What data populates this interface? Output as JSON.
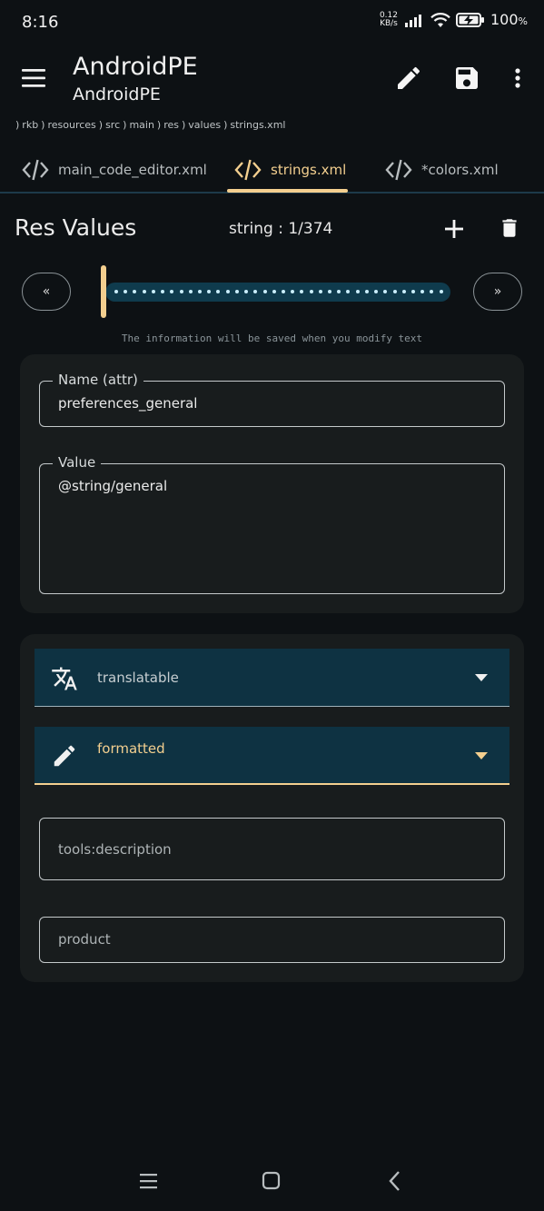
{
  "status_bar": {
    "time": "8:16",
    "net_speed_value": "0.12",
    "net_speed_unit": "KB/s",
    "battery_percent": "100",
    "battery_unit": "%"
  },
  "header": {
    "title": "AndroidPE",
    "subtitle": "AndroidPE",
    "icons": [
      "menu-icon",
      "pencil-icon",
      "save-icon",
      "more-vert-icon"
    ]
  },
  "breadcrumb": [
    "rkb",
    "resources",
    "src",
    "main",
    "res",
    "values",
    "strings.xml"
  ],
  "tabs": [
    {
      "label": "main_code_editor.xml",
      "active": false
    },
    {
      "label": "strings.xml",
      "active": true
    },
    {
      "label": "*colors.xml",
      "active": false
    }
  ],
  "res_values": {
    "title": "Res Values",
    "counter": "string : 1/374",
    "prev_label": "«",
    "next_label": "»",
    "position": "1/374",
    "info_note": "The information will be saved when you modify text"
  },
  "form": {
    "name_label": "Name (attr)",
    "name_value": "preferences_general",
    "value_label": "Value",
    "value_value": "@string/general"
  },
  "attributes": {
    "translatable_label": "translatable",
    "formatted_label": "formatted",
    "tools_description_placeholder": "tools:description",
    "product_placeholder": "product"
  },
  "colors": {
    "background": "#0d1114",
    "card": "#181c1d",
    "accent": "#f3cf8f",
    "dropdown_bg": "#0e3242",
    "slider_track": "#0f3b4d"
  }
}
